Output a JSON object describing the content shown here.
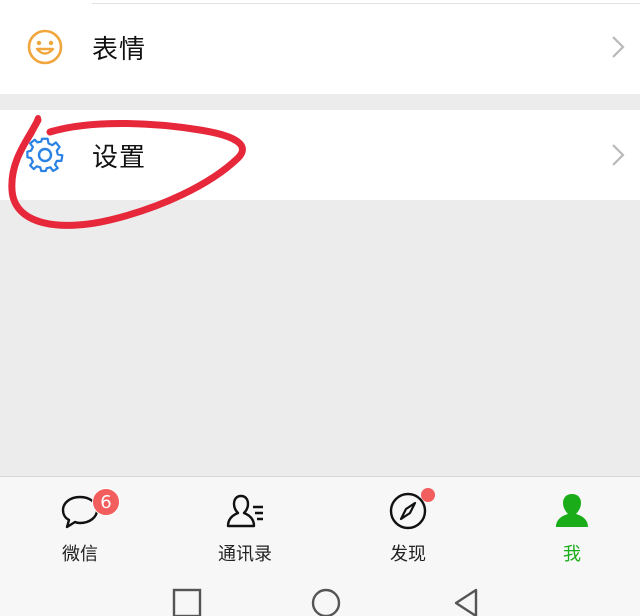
{
  "list": {
    "emoji_row": {
      "label": "表情",
      "icon": "smiley-icon"
    },
    "settings_row": {
      "label": "设置",
      "icon": "gear-icon"
    }
  },
  "tabbar": {
    "tabs": [
      {
        "label": "微信",
        "icon": "chat-bubble-icon",
        "badge": "6"
      },
      {
        "label": "通讯录",
        "icon": "contacts-icon"
      },
      {
        "label": "发现",
        "icon": "compass-icon",
        "dot": true
      },
      {
        "label": "我",
        "icon": "person-icon",
        "active": true
      }
    ]
  },
  "colors": {
    "accent_green": "#1aad19",
    "badge_red": "#f25d5d",
    "annotation_red": "#e6283a",
    "emoji_orange": "#f0a63c",
    "gear_blue": "#2a82e4"
  },
  "system_nav": {
    "buttons": [
      "recent-apps-icon",
      "home-icon",
      "back-icon"
    ]
  }
}
